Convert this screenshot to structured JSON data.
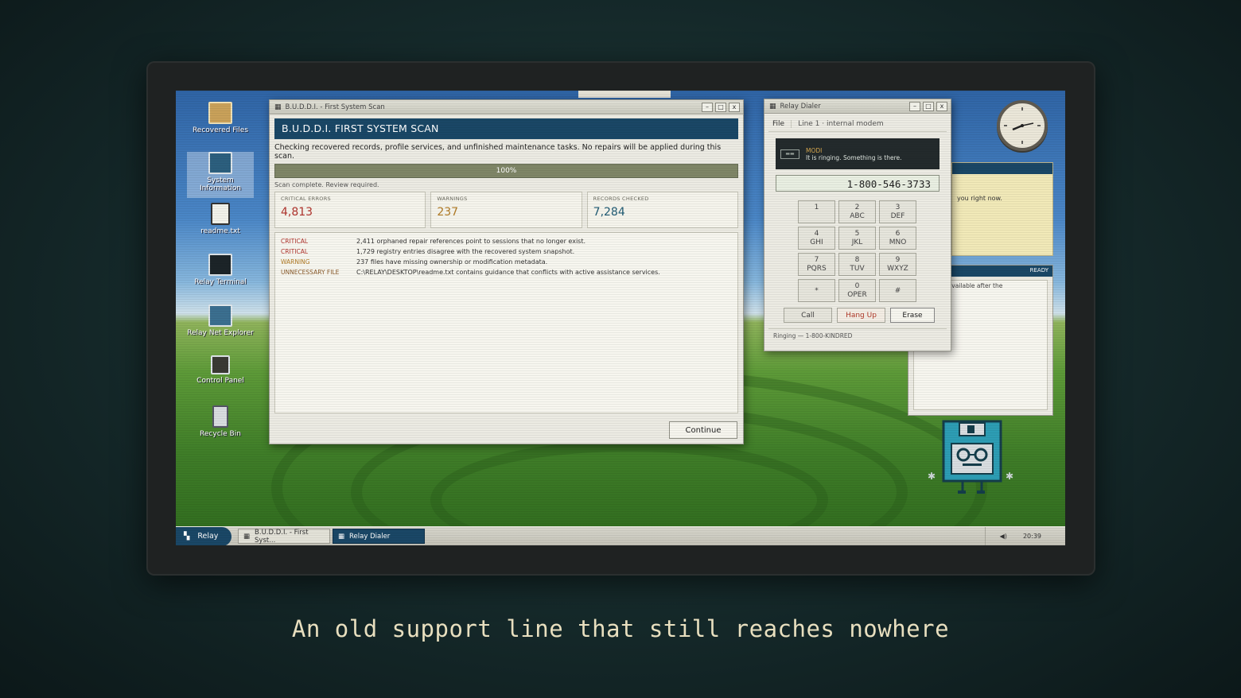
{
  "desktop_icons": [
    {
      "label": "Recovered Files",
      "icon": "folder-icon"
    },
    {
      "label": "System Information",
      "icon": "monitor-icon"
    },
    {
      "label": "readme.txt",
      "icon": "document-icon"
    },
    {
      "label": "Relay Terminal",
      "icon": "terminal-icon"
    },
    {
      "label": "Relay Net Explorer",
      "icon": "browser-icon"
    },
    {
      "label": "Control Panel",
      "icon": "control-panel-icon"
    },
    {
      "label": "Recycle Bin",
      "icon": "trash-icon"
    }
  ],
  "scan_window": {
    "title": "B.U.D.D.I. - First System Scan",
    "header": "B.U.D.D.I. FIRST SYSTEM SCAN",
    "description": "Checking recovered records, profile services, and unfinished maintenance tasks. No repairs will be applied during this scan.",
    "progress_label": "100%",
    "progress_percent": 100,
    "status": "Scan complete. Review required.",
    "stats": [
      {
        "label": "CRITICAL ERRORS",
        "value": "4,813",
        "color": "#b0332c"
      },
      {
        "label": "WARNINGS",
        "value": "237",
        "color": "#b07a24"
      },
      {
        "label": "RECORDS CHECKED",
        "value": "7,284",
        "color": "#1f5a73"
      }
    ],
    "log": [
      {
        "level": "CRITICAL",
        "text": "2,411 orphaned repair references point to sessions that no longer exist.",
        "color": "#b0332c"
      },
      {
        "level": "CRITICAL",
        "text": "1,729 registry entries disagree with the recovered system snapshot.",
        "color": "#b0332c"
      },
      {
        "level": "WARNING",
        "text": "237 files have missing ownership or modification metadata.",
        "color": "#b07a24"
      },
      {
        "level": "UNNECESSARY FILE",
        "text": "C:\\RELAY\\DESKTOP\\readme.txt contains guidance that conflicts with active assistance services.",
        "color": "#8a5a2a"
      }
    ],
    "continue_label": "Continue"
  },
  "dialer": {
    "title": "Relay Dialer",
    "menu_file": "File",
    "line_label": "Line 1 · internal modem",
    "modem_name": "MODI",
    "modem_message": "It is ringing. Something is there.",
    "modem_icon_label": "▬▬",
    "number": "1-800-546-3733",
    "keys": [
      {
        "main": "1",
        "sub": ""
      },
      {
        "main": "2",
        "sub": "ABC"
      },
      {
        "main": "3",
        "sub": "DEF"
      },
      {
        "main": "4",
        "sub": "GHI"
      },
      {
        "main": "5",
        "sub": "JKL"
      },
      {
        "main": "6",
        "sub": "MNO"
      },
      {
        "main": "7",
        "sub": "PQRS"
      },
      {
        "main": "8",
        "sub": "TUV"
      },
      {
        "main": "9",
        "sub": "WXYZ"
      },
      {
        "main": "*",
        "sub": ""
      },
      {
        "main": "0",
        "sub": "OPER"
      },
      {
        "main": "#",
        "sub": ""
      }
    ],
    "call_label": "Call",
    "hangup_label": "Hang Up",
    "erase_label": "Erase",
    "status": "Ringing — 1-800-KINDRED"
  },
  "background_windows": {
    "note_text": "you right now.",
    "ready_label": "READY",
    "ready_text": "s become available after the"
  },
  "taskbar": {
    "start_label": "Relay",
    "tasks": [
      "B.U.D.D.I. - First Syst...",
      "Relay Dialer"
    ],
    "time": "20:39"
  },
  "caption": "An old support line that still reaches nowhere",
  "colors": {
    "accent": "#1a4766",
    "critical": "#b0332c",
    "warning": "#b07a24",
    "caption": "#e8dfbf"
  }
}
